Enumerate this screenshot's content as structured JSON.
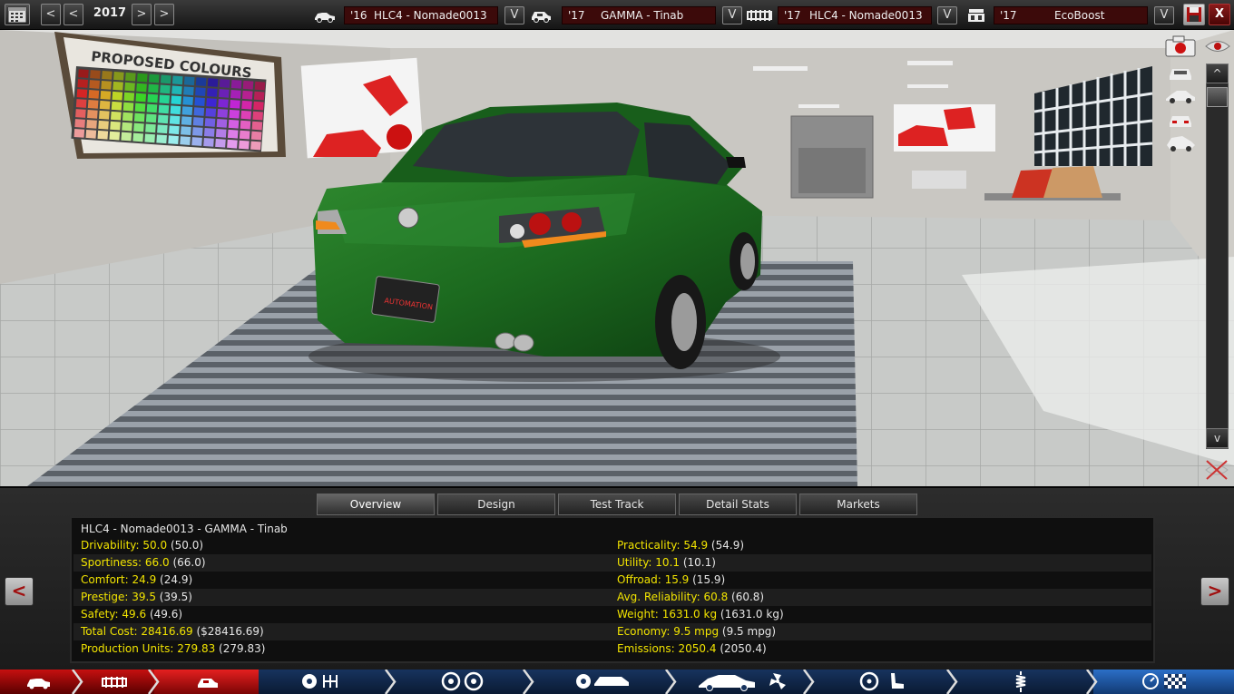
{
  "topbar": {
    "year": "2017",
    "year_prev_label": "<",
    "year_prev2_label": "<",
    "year_next_label": ">",
    "year_next2_label": ">",
    "model": {
      "year": "'16",
      "name": "HLC4 - Nomade0013",
      "dropdown_label": "V"
    },
    "trim": {
      "year": "'17",
      "name": "GAMMA - Tinab",
      "dropdown_label": "V"
    },
    "chassis": {
      "year": "'17",
      "name": "HLC4 - Nomade0013",
      "dropdown_label": "V"
    },
    "engine": {
      "year": "'17",
      "name": "EcoBoost",
      "dropdown_label": "V"
    },
    "close_label": "X"
  },
  "viewport": {
    "poster_colours": "PROPOSED COLOURS",
    "license_plate": "AUTOMATION",
    "scroll_up_label": "^",
    "scroll_down_label": "v"
  },
  "panel": {
    "tabs": [
      {
        "label": "Overview",
        "active": true
      },
      {
        "label": "Design",
        "active": false
      },
      {
        "label": "Test Track",
        "active": false
      },
      {
        "label": "Detail Stats",
        "active": false
      },
      {
        "label": "Markets",
        "active": false
      }
    ],
    "prev_label": "<",
    "next_label": ">",
    "car_title": "HLC4 - Nomade0013 - GAMMA - Tinab",
    "stats_left": [
      {
        "label": "Drivability:",
        "value": "50.0",
        "paren": "(50.0)"
      },
      {
        "label": "Sportiness:",
        "value": "66.0",
        "paren": "(66.0)"
      },
      {
        "label": "Comfort:",
        "value": "24.9",
        "paren": "(24.9)"
      },
      {
        "label": "Prestige:",
        "value": "39.5",
        "paren": "(39.5)"
      },
      {
        "label": "Safety:",
        "value": "49.6",
        "paren": "(49.6)"
      },
      {
        "label": "Total Cost:",
        "value": "28416.69",
        "paren": "($28416.69)"
      },
      {
        "label": "Production Units:",
        "value": "279.83",
        "paren": "(279.83)"
      }
    ],
    "stats_right": [
      {
        "label": "Practicality:",
        "value": "54.9",
        "paren": "(54.9)"
      },
      {
        "label": "Utility:",
        "value": "10.1",
        "paren": "(10.1)"
      },
      {
        "label": "Offroad:",
        "value": "15.9",
        "paren": "(15.9)"
      },
      {
        "label": "Avg. Reliability:",
        "value": "60.8",
        "paren": "(60.8)"
      },
      {
        "label": "Weight:",
        "value": "1631.0 kg",
        "paren": "(1631.0 kg)"
      },
      {
        "label": "Economy:",
        "value": "9.5 mpg",
        "paren": "(9.5 mpg)"
      },
      {
        "label": "Emissions:",
        "value": "2050.4",
        "paren": "(2050.4)"
      }
    ]
  },
  "bottomnav": {
    "steps": [
      "model-icon",
      "chassis-icon",
      "trim-icon",
      "engine-gearbox-icon",
      "wheels-icon",
      "brakes-body-icon",
      "body-aero-icon",
      "interior-icon",
      "suspension-icon",
      "test-finish-icon"
    ],
    "active_step": 2
  },
  "colors": {
    "accent_red": "#8a1a1a",
    "stat_yellow": "#f2e400",
    "car_green": "#1f6b1f",
    "nav_blue": "#17335e"
  }
}
